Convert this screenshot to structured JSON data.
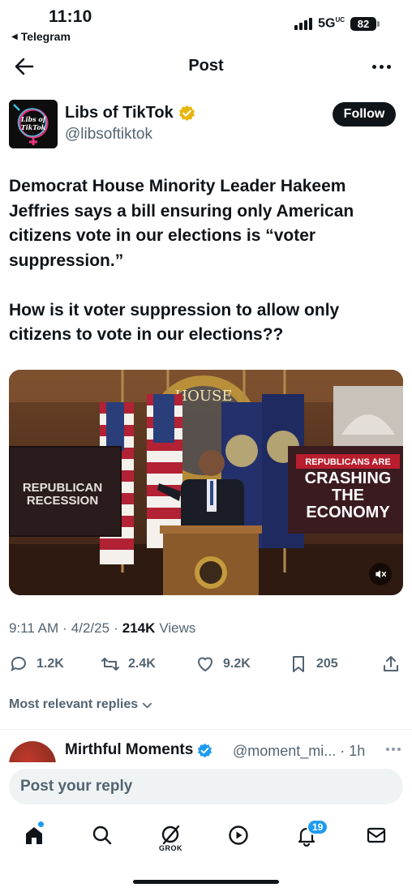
{
  "status_bar": {
    "time": "11:10",
    "back_app": "Telegram",
    "network": "5G",
    "network_sup": "UC",
    "battery": "82"
  },
  "header": {
    "title": "Post"
  },
  "author": {
    "name": "Libs of TikTok",
    "handle": "@libsoftiktok",
    "avatar_text_1": "Libs of",
    "avatar_text_2": "TikTok",
    "verified_color": "#e8b50a"
  },
  "follow_label": "Follow",
  "post": {
    "text": "Democrat House Minority Leader Hakeem Jeffries says a bill ensuring only American citizens vote in our elections is “voter suppression.”\n\nHow is it voter suppression to allow only citizens to vote in our elections??"
  },
  "media": {
    "left_sign": "REPUBLICAN RECESSION",
    "right_sign_small": "REPUBLICANS ARE",
    "right_sign_l1": "CRASHING",
    "right_sign_l2": "THE",
    "right_sign_l3": "ECONOMY",
    "seal_text": "HOUSE",
    "seal_text_2": "U.S. HOUSE OF REPRESENTATIVES",
    "mute_icon": "speaker-muted-icon"
  },
  "meta": {
    "time": "9:11 AM",
    "date": "4/2/25",
    "views_count": "214K",
    "views_label": "Views"
  },
  "actions": {
    "replies": "1.2K",
    "reposts": "2.4K",
    "likes": "9.2K",
    "bookmarks": "205"
  },
  "replies_filter": "Most relevant replies",
  "reply_preview": {
    "name": "Mirthful Moments",
    "handle": "@moment_mi... · 1h"
  },
  "reply_box": {
    "placeholder": "Post your reply"
  },
  "tabbar": {
    "grok_label": "GROK",
    "notifications_badge": "19"
  },
  "colors": {
    "accent": "#1d9bf0",
    "text": "#0f1419",
    "muted": "#536471"
  }
}
